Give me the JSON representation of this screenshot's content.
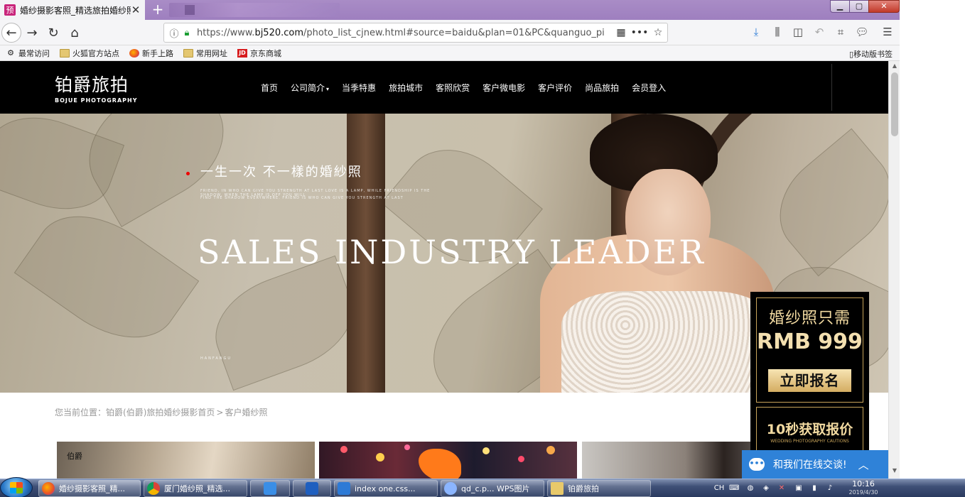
{
  "browser": {
    "active_tab_title": "婚纱摄影客照_精选旅拍婚纱照",
    "active_tab_favicon": "预",
    "url_prefix": "https://www.",
    "url_domain": "bj520.com",
    "url_path": "/photo_list_cjnew.html#source=baidu&plan=01&PC&quanguo_pi",
    "new_tab_glyph": "+",
    "close_glyph": "✕"
  },
  "bookmarks": {
    "items": [
      {
        "label": "最常访问",
        "icon": "gear-icon"
      },
      {
        "label": "火狐官方站点",
        "icon": "folder-icon"
      },
      {
        "label": "新手上路",
        "icon": "firefox-icon"
      },
      {
        "label": "常用网址",
        "icon": "folder-icon"
      },
      {
        "label": "京东商城",
        "icon": "jd-icon"
      }
    ],
    "jd_badge": "JD",
    "mobile": "移动版书签"
  },
  "site": {
    "logo_main": "铂爵旅拍",
    "logo_sub": "BOJUE PHOTOGRAPHY",
    "nav": [
      "首页",
      "公司简介",
      "当季特惠",
      "旅拍城市",
      "客照欣赏",
      "客户微电影",
      "客户评价",
      "尚品旅拍",
      "会员登入"
    ]
  },
  "hero": {
    "tagline": "一生一次 不一樣的婚紗照",
    "headline": "SALES INDUSTRY LEADER",
    "small_text_1": "FRIEND, IN WHO CAN GIVE YOU STRENGTH AT LAST LOVE IS A LAMP, WHILE FRIENDSHIP IS THE SHADOW. WHEN THE LAMP IS OFF YOU WILL",
    "small_text_2": "FIND THE SHADOW EVERYWHERE. FRIEND IS WHO CAN GIVE YOU STRENGTH AT LAST",
    "signature": "HANFANGU"
  },
  "breadcrumb": {
    "prefix": "您当前位置：",
    "home": "铂爵(伯爵)旅拍婚纱摄影首页",
    "separator": ">",
    "current": "客户婚纱照"
  },
  "gallery": {
    "thumb1_text": "伯爵"
  },
  "promo": {
    "line1": "婚纱照只需",
    "line2": "RMB 999",
    "cta": "立即报名",
    "line3": "10秒获取报价",
    "line4": "WEDDING PHOTOGRAPHY CAUTIONS"
  },
  "chat": {
    "label": "和我们在线交谈!",
    "toggle": "︿"
  },
  "taskbar": {
    "tasks": [
      "婚纱摄影客照_精...",
      "厦门婚纱照_精选...",
      "index one.css...",
      "qd_c.p... WPS图片",
      "铂爵旅拍"
    ],
    "clock_time": "10:16",
    "clock_date": "2019/4/30",
    "lang": "CH"
  },
  "colors": {
    "header_bg": "#000000",
    "chat_blue": "#2f82d8",
    "promo_gold": "#c7a35a",
    "titlebar_purple": "#a98cc6"
  }
}
